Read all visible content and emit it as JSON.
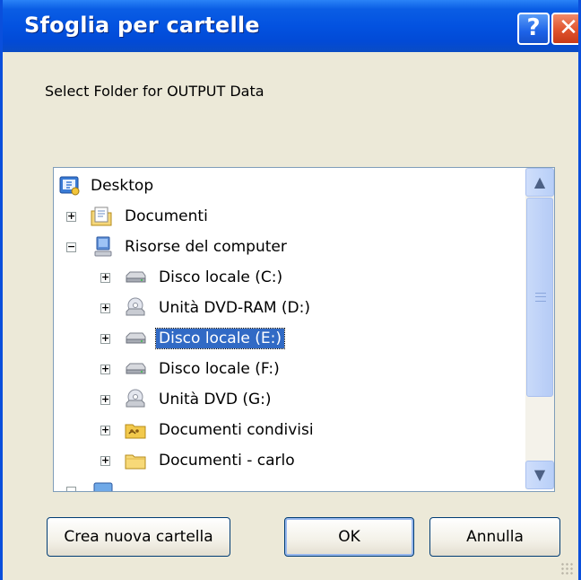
{
  "window": {
    "title": "Sfoglia per cartelle",
    "help_glyph": "?",
    "close_glyph": "✕"
  },
  "prompt": "Select Folder for OUTPUT Data",
  "tree": {
    "items": [
      {
        "label": "Desktop",
        "icon": "desktop-icon"
      },
      {
        "label": "Documenti",
        "icon": "documents-folder-icon",
        "expander": "+"
      },
      {
        "label": "Risorse del computer",
        "icon": "my-computer-icon",
        "expander": "−"
      },
      {
        "label": "Disco locale (C:)",
        "icon": "hard-drive-icon",
        "expander": "+"
      },
      {
        "label": "Unità DVD-RAM (D:)",
        "icon": "dvd-drive-icon",
        "expander": "+"
      },
      {
        "label": "Disco locale (E:)",
        "icon": "hard-drive-icon",
        "expander": "+",
        "selected": true
      },
      {
        "label": "Disco locale (F:)",
        "icon": "hard-drive-icon",
        "expander": "+"
      },
      {
        "label": "Unità DVD (G:)",
        "icon": "dvd-drive-icon",
        "expander": "+"
      },
      {
        "label": "Documenti condivisi",
        "icon": "shared-folder-icon",
        "expander": "+"
      },
      {
        "label": "Documenti - carlo",
        "icon": "folder-icon",
        "expander": "+"
      }
    ]
  },
  "scrollbar": {
    "up_glyph": "▲",
    "down_glyph": "▼"
  },
  "buttons": {
    "new_folder": "Crea nuova cartella",
    "ok": "OK",
    "cancel": "Annulla"
  },
  "colors": {
    "titlebar": "#0352e0",
    "selection": "#316ac5",
    "dialog_bg": "#ece9d8"
  }
}
